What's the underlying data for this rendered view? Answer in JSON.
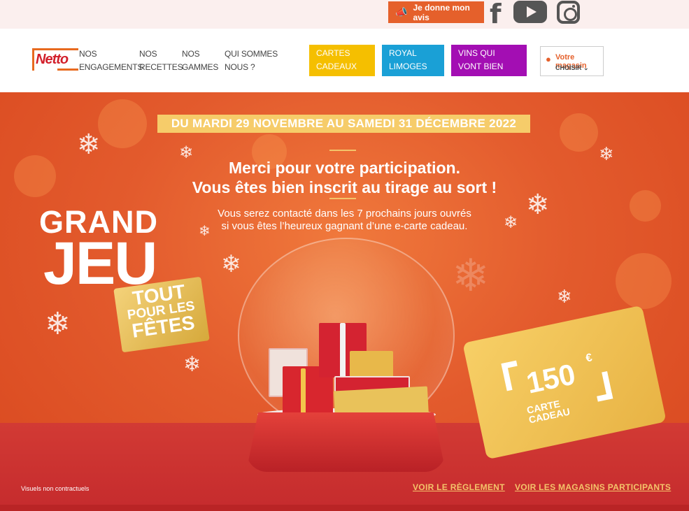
{
  "topbar": {
    "avis_label": "Je donne mon avis",
    "social": [
      "facebook-icon",
      "youtube-icon",
      "instagram-icon"
    ]
  },
  "nav": {
    "logo": "Netto",
    "links": [
      {
        "label": "NOS ENGAGEMENTS"
      },
      {
        "label": "NOS RECETTES"
      },
      {
        "label": "NOS GAMMES"
      },
      {
        "label": "QUI SOMMES NOUS ?"
      }
    ],
    "boxes": [
      {
        "label": "CARTES CADEAUX",
        "color": "#f5bf00"
      },
      {
        "label": "ROYAL LIMOGES",
        "color": "#1aa0d6"
      },
      {
        "label": "VINS QUI VONT BIEN",
        "color": "#a30eb3"
      }
    ],
    "store": {
      "title": "Votre magasin",
      "action": "CHOISIR"
    }
  },
  "hero": {
    "dates": "DU MARDI 29 NOVEMBRE AU SAMEDI 31 DÉCEMBRE 2022",
    "merci_line1": "Merci pour votre participation.",
    "merci_line2": "Vous êtes bien inscrit au tirage au sort !",
    "contact_line1": "Vous serez contacté dans les 7 prochains jours ouvrés",
    "contact_line2": "si vous êtes l’heureux gagnant d’une e-carte cadeau.",
    "grand": "GRAND",
    "jeu": "JEU",
    "tag_line1": "TOUT",
    "tag_line2": "POUR LES",
    "tag_line3": "FÊTES",
    "card_amount": "150",
    "card_currency": "€",
    "card_line1": "CARTE",
    "card_line2": "CADEAU",
    "visuels": "Visuels non contractuels",
    "link_reglement": "VOIR LE RÈGLEMENT",
    "link_magasins": "VOIR LES MAGASINS PARTICIPANTS"
  },
  "colors": {
    "accent": "#e5602b",
    "hero_bg": "#e35b2d",
    "gold": "#f6cc6a",
    "brand_red": "#d21f2a"
  }
}
